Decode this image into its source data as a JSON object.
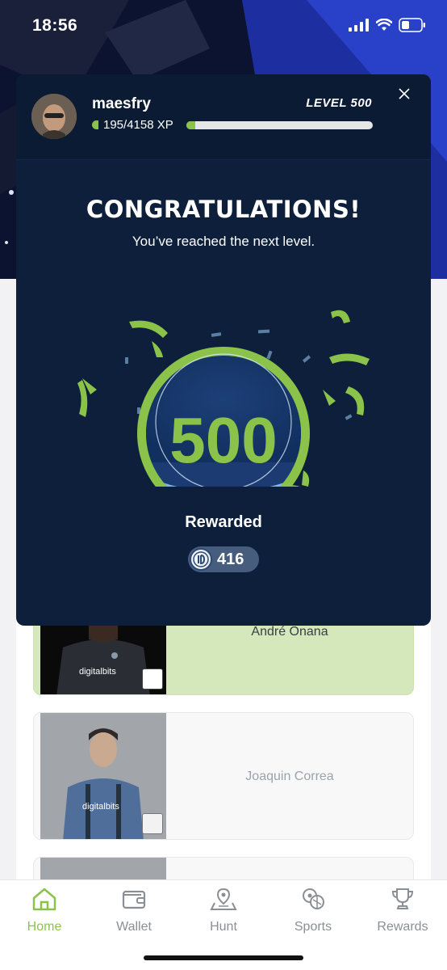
{
  "status_bar": {
    "time": "18:56"
  },
  "modal": {
    "username": "maesfry",
    "level_label": "LEVEL 500",
    "xp_text": "195/4158 XP",
    "xp_progress": 0.047,
    "close_icon": "close-icon",
    "title": "CONGRATULATIONS!",
    "subtitle": "You’ve reached the next level.",
    "badge_level": "500",
    "rewarded_label": "Rewarded",
    "reward_amount": "416"
  },
  "players": [
    {
      "name": "André Onana",
      "jersey_text": "digitalbits"
    },
    {
      "name": "Joaquin Correa",
      "jersey_text": "digitalbits"
    }
  ],
  "bottom_nav": [
    {
      "label": "Home",
      "icon": "home-icon",
      "active": true
    },
    {
      "label": "Wallet",
      "icon": "wallet-icon",
      "active": false
    },
    {
      "label": "Hunt",
      "icon": "map-pin-icon",
      "active": false
    },
    {
      "label": "Sports",
      "icon": "sports-balls-icon",
      "active": false
    },
    {
      "label": "Rewards",
      "icon": "trophy-icon",
      "active": false
    }
  ],
  "colors": {
    "accent": "#8bc34a",
    "modal_bg": "#0d1f3a",
    "badge_light_blue": "#7ab8f0",
    "nav_inactive": "#8a8f95"
  }
}
